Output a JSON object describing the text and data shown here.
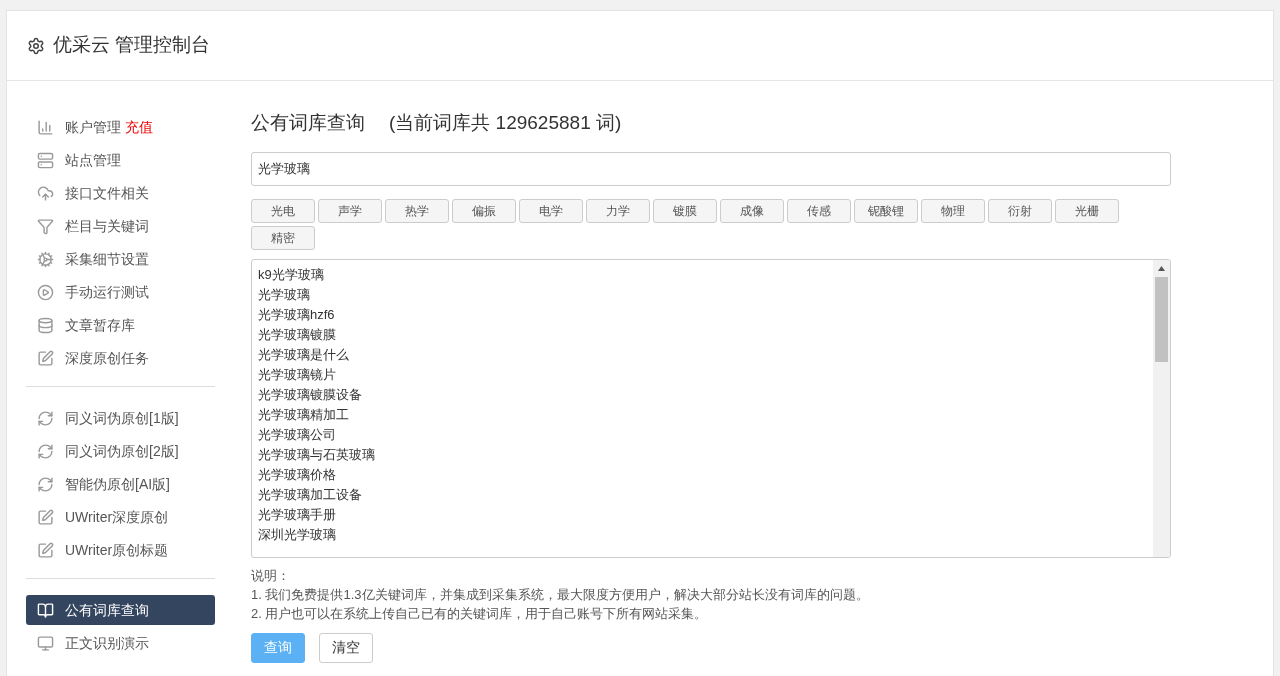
{
  "header": {
    "title": "优采云 管理控制台"
  },
  "sidebar": {
    "groups": [
      {
        "items": [
          {
            "label": "账户管理",
            "badge": "充值",
            "selected": false
          },
          {
            "label": "站点管理",
            "selected": false
          },
          {
            "label": "接口文件相关",
            "selected": false
          },
          {
            "label": "栏目与关键词",
            "selected": false
          },
          {
            "label": "采集细节设置",
            "selected": false
          },
          {
            "label": "手动运行测试",
            "selected": false
          },
          {
            "label": "文章暂存库",
            "selected": false
          },
          {
            "label": "深度原创任务",
            "selected": false
          }
        ]
      },
      {
        "items": [
          {
            "label": "同义词伪原创[1版]",
            "selected": false
          },
          {
            "label": "同义词伪原创[2版]",
            "selected": false
          },
          {
            "label": "智能伪原创[AI版]",
            "selected": false
          },
          {
            "label": "UWriter深度原创",
            "selected": false
          },
          {
            "label": "UWriter原创标题",
            "selected": false
          }
        ]
      },
      {
        "items": [
          {
            "label": "公有词库查询",
            "selected": true
          },
          {
            "label": "正文识别演示",
            "selected": false
          }
        ]
      }
    ]
  },
  "main": {
    "title": "公有词库查询",
    "subtitle": "(当前词库共 129625881 词)",
    "search": {
      "value": "光学玻璃"
    },
    "tags": [
      "光电",
      "声学",
      "热学",
      "偏振",
      "电学",
      "力学",
      "镀膜",
      "成像",
      "传感",
      "铌酸锂",
      "物理",
      "衍射",
      "光栅",
      "精密"
    ],
    "results": [
      "k9光学玻璃",
      "光学玻璃",
      "光学玻璃hzf6",
      "光学玻璃镀膜",
      "光学玻璃是什么",
      "光学玻璃镜片",
      "光学玻璃镀膜设备",
      "光学玻璃精加工",
      "光学玻璃公司",
      "光学玻璃与石英玻璃",
      "光学玻璃价格",
      "光学玻璃加工设备",
      "光学玻璃手册",
      "深圳光学玻璃"
    ],
    "notes_title": "说明：",
    "notes": [
      "1. 我们免费提供1.3亿关键词库，并集成到采集系统，最大限度方便用户，解决大部分站长没有词库的问题。",
      "2. 用户也可以在系统上传自己已有的关键词库，用于自己账号下所有网站采集。"
    ],
    "buttons": [
      {
        "label": "查询",
        "kind": "primary"
      },
      {
        "label": "清空",
        "kind": "default"
      }
    ]
  }
}
